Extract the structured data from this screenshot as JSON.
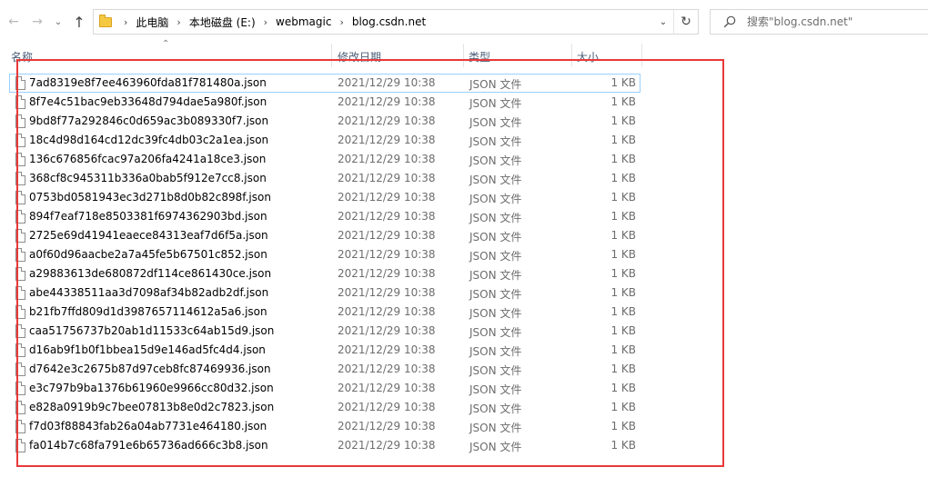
{
  "nav": {
    "back_icon": "arrow-left-icon",
    "forward_icon": "arrow-right-icon",
    "recent_icon": "chevron-down-icon",
    "up_icon": "arrow-up-icon"
  },
  "address": {
    "breadcrumbs": [
      "此电脑",
      "本地磁盘 (E:)",
      "webmagic",
      "blog.csdn.net"
    ],
    "separator": "›"
  },
  "search": {
    "placeholder": "搜索\"blog.csdn.net\""
  },
  "columns": {
    "name": "名称",
    "date": "修改日期",
    "type": "类型",
    "size": "大小"
  },
  "files": [
    {
      "name": "7ad8319e8f7ee463960fda81f781480a.json",
      "date": "2021/12/29 10:38",
      "type": "JSON 文件",
      "size": "1 KB",
      "selected": true
    },
    {
      "name": "8f7e4c51bac9eb33648d794dae5a980f.json",
      "date": "2021/12/29 10:38",
      "type": "JSON 文件",
      "size": "1 KB"
    },
    {
      "name": "9bd8f77a292846c0d659ac3b089330f7.json",
      "date": "2021/12/29 10:38",
      "type": "JSON 文件",
      "size": "1 KB"
    },
    {
      "name": "18c4d98d164cd12dc39fc4db03c2a1ea.json",
      "date": "2021/12/29 10:38",
      "type": "JSON 文件",
      "size": "1 KB"
    },
    {
      "name": "136c676856fcac97a206fa4241a18ce3.json",
      "date": "2021/12/29 10:38",
      "type": "JSON 文件",
      "size": "1 KB"
    },
    {
      "name": "368cf8c945311b336a0bab5f912e7cc8.json",
      "date": "2021/12/29 10:38",
      "type": "JSON 文件",
      "size": "1 KB"
    },
    {
      "name": "0753bd0581943ec3d271b8d0b82c898f.json",
      "date": "2021/12/29 10:38",
      "type": "JSON 文件",
      "size": "1 KB"
    },
    {
      "name": "894f7eaf718e8503381f6974362903bd.json",
      "date": "2021/12/29 10:38",
      "type": "JSON 文件",
      "size": "1 KB"
    },
    {
      "name": "2725e69d41941eaece84313eaf7d6f5a.json",
      "date": "2021/12/29 10:38",
      "type": "JSON 文件",
      "size": "1 KB"
    },
    {
      "name": "a0f60d96aacbe2a7a45fe5b67501c852.json",
      "date": "2021/12/29 10:38",
      "type": "JSON 文件",
      "size": "1 KB"
    },
    {
      "name": "a29883613de680872df114ce861430ce.json",
      "date": "2021/12/29 10:38",
      "type": "JSON 文件",
      "size": "1 KB"
    },
    {
      "name": "abe44338511aa3d7098af34b82adb2df.json",
      "date": "2021/12/29 10:38",
      "type": "JSON 文件",
      "size": "1 KB"
    },
    {
      "name": "b21fb7ffd809d1d3987657114612a5a6.json",
      "date": "2021/12/29 10:38",
      "type": "JSON 文件",
      "size": "1 KB"
    },
    {
      "name": "caa51756737b20ab1d11533c64ab15d9.json",
      "date": "2021/12/29 10:38",
      "type": "JSON 文件",
      "size": "1 KB"
    },
    {
      "name": "d16ab9f1b0f1bbea15d9e146ad5fc4d4.json",
      "date": "2021/12/29 10:38",
      "type": "JSON 文件",
      "size": "1 KB"
    },
    {
      "name": "d7642e3c2675b87d97ceb8fc87469936.json",
      "date": "2021/12/29 10:38",
      "type": "JSON 文件",
      "size": "1 KB"
    },
    {
      "name": "e3c797b9ba1376b61960e9966cc80d32.json",
      "date": "2021/12/29 10:38",
      "type": "JSON 文件",
      "size": "1 KB"
    },
    {
      "name": "e828a0919b9c7bee07813b8e0d2c7823.json",
      "date": "2021/12/29 10:38",
      "type": "JSON 文件",
      "size": "1 KB"
    },
    {
      "name": "f7d03f88843fab26a04ab7731e464180.json",
      "date": "2021/12/29 10:38",
      "type": "JSON 文件",
      "size": "1 KB"
    },
    {
      "name": "fa014b7c68fa791e6b65736ad666c3b8.json",
      "date": "2021/12/29 10:38",
      "type": "JSON 文件",
      "size": "1 KB"
    }
  ],
  "colors": {
    "annotation_border": "#e8393a",
    "selection_border": "#99d1ff",
    "header_text": "#4c607a",
    "detail_text": "#6d6d6d"
  }
}
